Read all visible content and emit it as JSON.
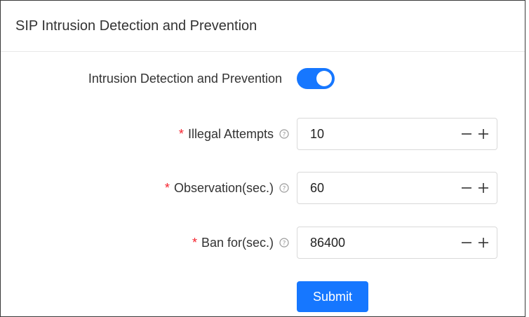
{
  "panel": {
    "title": "SIP Intrusion Detection and Prevention"
  },
  "form": {
    "toggle": {
      "label": "Intrusion Detection and Prevention",
      "enabled": true
    },
    "fields": [
      {
        "label": "Illegal Attempts",
        "required_mark": "*",
        "value": "10"
      },
      {
        "label": "Observation(sec.)",
        "required_mark": "*",
        "value": "60"
      },
      {
        "label": "Ban for(sec.)",
        "required_mark": "*",
        "value": "86400"
      }
    ],
    "submit_label": "Submit"
  },
  "colors": {
    "accent": "#1677ff",
    "required": "#f5222d"
  },
  "icons": {
    "help": "question-circle-icon",
    "decrement": "minus-icon",
    "increment": "plus-icon"
  }
}
